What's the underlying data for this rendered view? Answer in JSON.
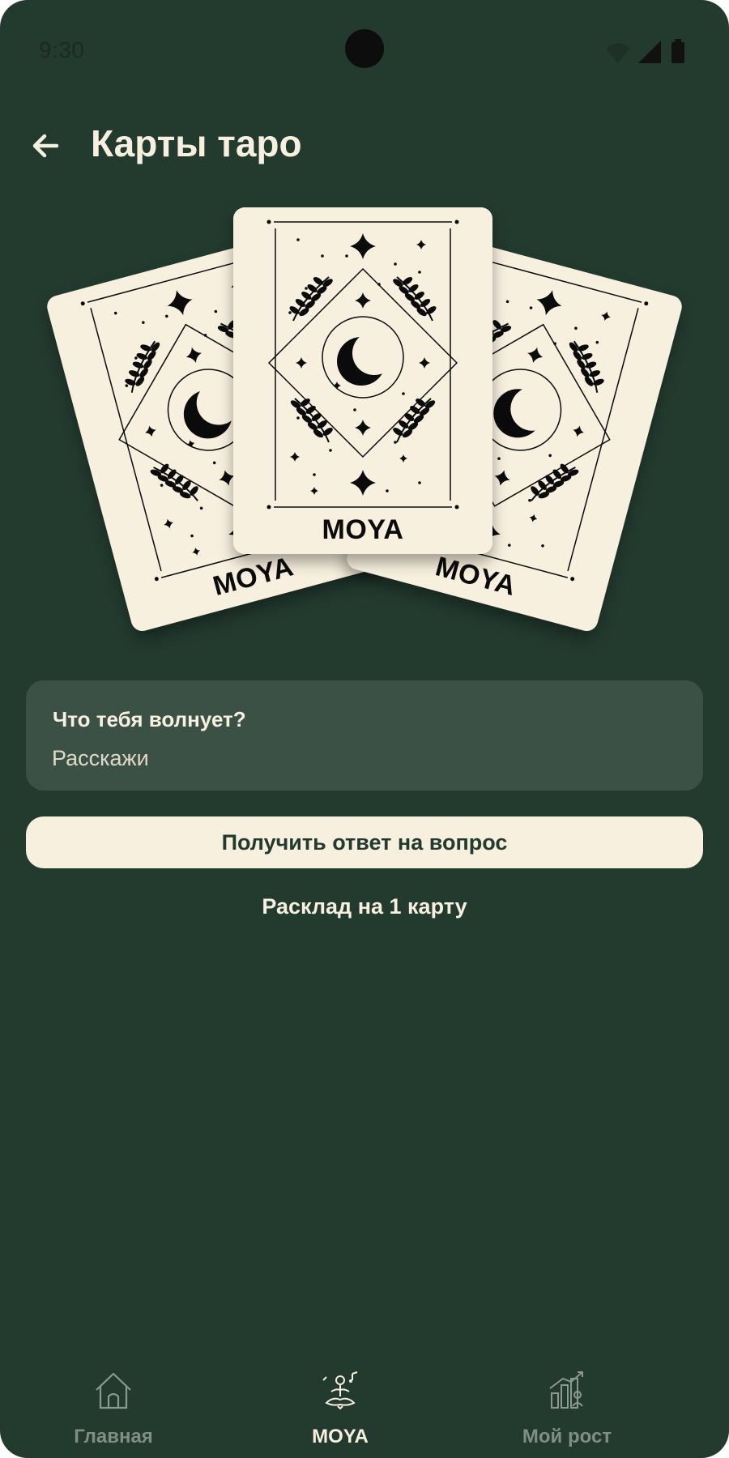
{
  "status_bar": {
    "time": "9:30",
    "icons": [
      "wifi-icon",
      "cellular-signal-icon",
      "battery-icon"
    ]
  },
  "header": {
    "back_icon": "arrow-left-icon",
    "title": "Карты таро"
  },
  "cards": [
    {
      "position": "left",
      "label": "MOYA"
    },
    {
      "position": "center",
      "label": "MOYA"
    },
    {
      "position": "right",
      "label": "MOYA"
    }
  ],
  "question": {
    "label": "Что тебя волнует?",
    "placeholder": "Расскажи",
    "value": ""
  },
  "actions": {
    "answer_button": "Получить ответ на вопрос",
    "spread_info": "Расклад на 1 карту"
  },
  "bottom_nav": {
    "items": [
      {
        "label": "Главная",
        "icon": "home-icon",
        "active": false
      },
      {
        "label": "MOYA",
        "icon": "meditation-icon",
        "active": true
      },
      {
        "label": "Мой рост",
        "icon": "growth-chart-icon",
        "active": false
      }
    ]
  },
  "colors": {
    "background": "#233a2f",
    "card": "#f8f0df",
    "input_bg": "#3b5145",
    "text_light": "#f7efdf",
    "nav_inactive": "#7f8f84"
  }
}
